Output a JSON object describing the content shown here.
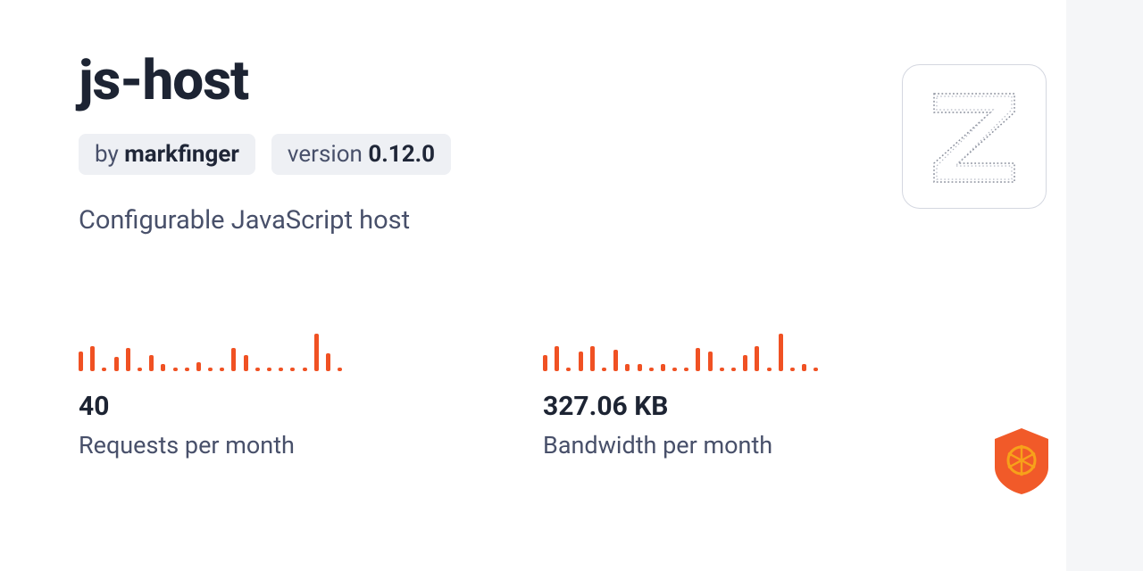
{
  "package": {
    "name": "js-host",
    "author_prefix": "by ",
    "author": "markfinger",
    "version_prefix": "version ",
    "version": "0.12.0",
    "description": "Configurable JavaScript host"
  },
  "stats": {
    "requests": {
      "value": "40",
      "label": "Requests per month"
    },
    "bandwidth": {
      "value": "327.06 KB",
      "label": "Bandwidth per month"
    }
  },
  "accent_color": "#f05123",
  "chart_data": [
    {
      "type": "bar",
      "title": "Requests per month sparkline",
      "values": [
        22,
        28,
        4,
        16,
        26,
        4,
        18,
        8,
        4,
        4,
        10,
        4,
        4,
        26,
        18,
        4,
        4,
        4,
        4,
        4,
        42,
        20,
        4
      ]
    },
    {
      "type": "bar",
      "title": "Bandwidth per month sparkline",
      "values": [
        18,
        28,
        4,
        22,
        28,
        4,
        24,
        8,
        8,
        4,
        8,
        4,
        4,
        26,
        22,
        4,
        4,
        18,
        28,
        4,
        42,
        4,
        8,
        4
      ]
    }
  ]
}
